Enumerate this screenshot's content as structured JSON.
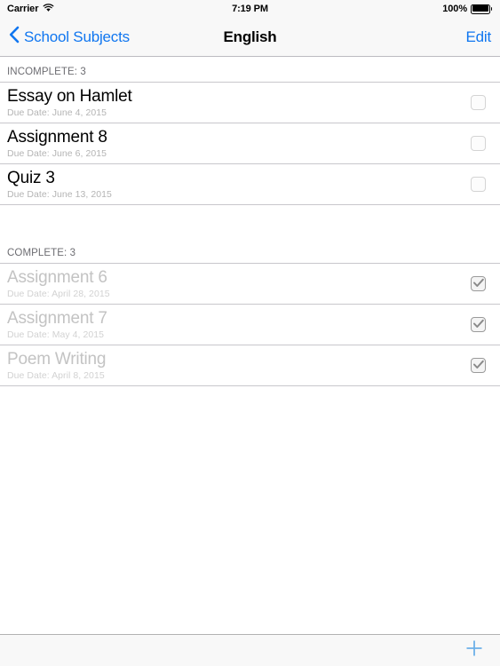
{
  "status_bar": {
    "carrier": "Carrier",
    "wifi_icon": "wifi-icon",
    "time": "7:19 PM",
    "battery_percent": "100%",
    "battery_icon": "battery-full-icon"
  },
  "nav_bar": {
    "back_icon": "chevron-left-icon",
    "back_label": "School Subjects",
    "title": "English",
    "edit_label": "Edit"
  },
  "sections": [
    {
      "header": "INCOMPLETE: 3",
      "rows": [
        {
          "title": "Essay on Hamlet",
          "subtitle": "Due Date: June 4, 2015",
          "checked": false
        },
        {
          "title": "Assignment 8",
          "subtitle": "Due Date: June 6, 2015",
          "checked": false
        },
        {
          "title": "Quiz 3",
          "subtitle": "Due Date: June 13, 2015",
          "checked": false
        }
      ]
    },
    {
      "header": "COMPLETE: 3",
      "rows": [
        {
          "title": "Assignment 6",
          "subtitle": "Due Date: April 28, 2015",
          "checked": true
        },
        {
          "title": "Assignment 7",
          "subtitle": "Due Date: May 4, 2015",
          "checked": true
        },
        {
          "title": "Poem Writing",
          "subtitle": "Due Date: April 8, 2015",
          "checked": true
        }
      ]
    }
  ],
  "toolbar": {
    "add_icon": "plus-icon",
    "add_label": "+"
  },
  "colors": {
    "tint": "#1076f0",
    "nav_background": "#f8f8f8",
    "separator": "#c8c7cc",
    "secondary_text": "#6d6d72",
    "disabled_text": "#c3c3c3"
  }
}
